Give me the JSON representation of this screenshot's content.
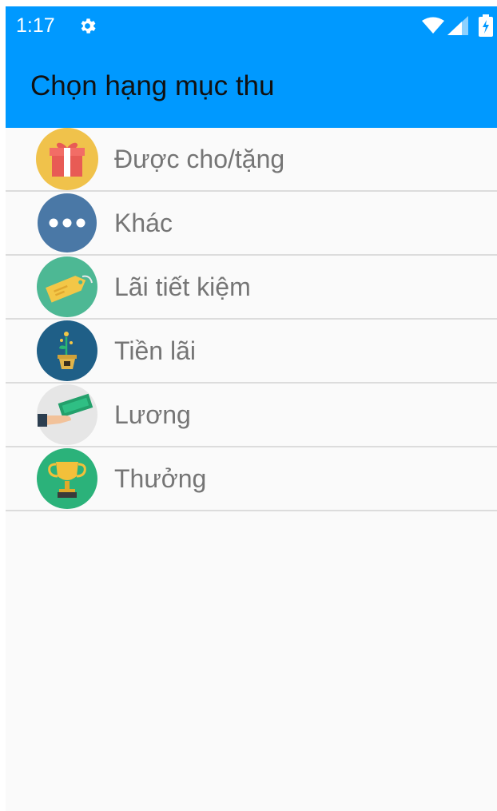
{
  "status_bar": {
    "time": "1:17",
    "icons": [
      "gear-icon",
      "wifi-icon",
      "signal-icon",
      "battery-icon"
    ]
  },
  "app_bar": {
    "title": "Chọn hạng mục thu",
    "color": "#0099ff"
  },
  "categories": [
    {
      "label": "Được cho/tặng",
      "icon": "gift-icon"
    },
    {
      "label": "Khác",
      "icon": "more-dots-icon"
    },
    {
      "label": "Lãi tiết kiệm",
      "icon": "tag-icon"
    },
    {
      "label": "Tiền lãi",
      "icon": "plant-pot-icon"
    },
    {
      "label": "Lương",
      "icon": "money-hand-icon"
    },
    {
      "label": "Thưởng",
      "icon": "trophy-icon"
    }
  ]
}
